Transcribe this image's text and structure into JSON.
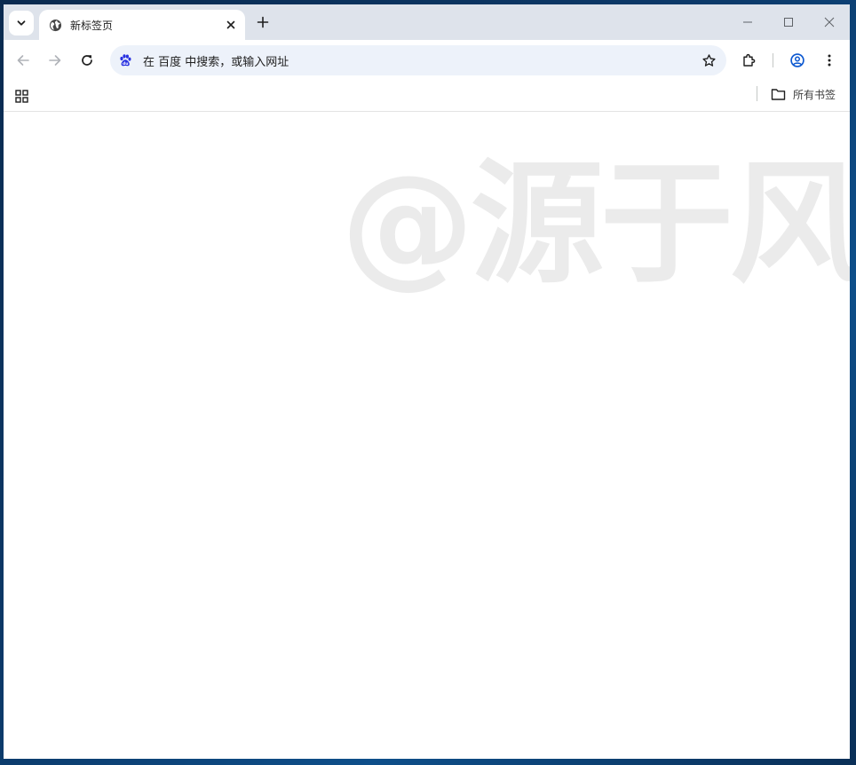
{
  "tab": {
    "title": "新标签页"
  },
  "omnibox": {
    "text": "在 百度 中搜索，或输入网址"
  },
  "bookmarks": {
    "all_label": "所有书签"
  },
  "watermark": {
    "text": "@源于风"
  },
  "icons": {
    "tab_search": "chevron-down-icon",
    "favicon": "globe-icon",
    "tab_close": "close-icon",
    "new_tab": "plus-icon",
    "minimize": "minimize-icon",
    "maximize": "maximize-icon",
    "window_close": "close-icon",
    "back": "arrow-left-icon",
    "forward": "arrow-right-icon",
    "reload": "reload-icon",
    "search_engine": "baidu-paw-icon",
    "bookmark_star": "star-icon",
    "extensions": "puzzle-icon",
    "profile": "account-circle-icon",
    "menu": "more-vertical-icon",
    "apps": "apps-grid-icon",
    "bookmarks_folder": "folder-icon"
  },
  "colors": {
    "titlebar": "#dee3eb",
    "omnibox": "#edf2fa",
    "baidu_blue": "#2932e1",
    "watermark": "#ebebeb"
  }
}
